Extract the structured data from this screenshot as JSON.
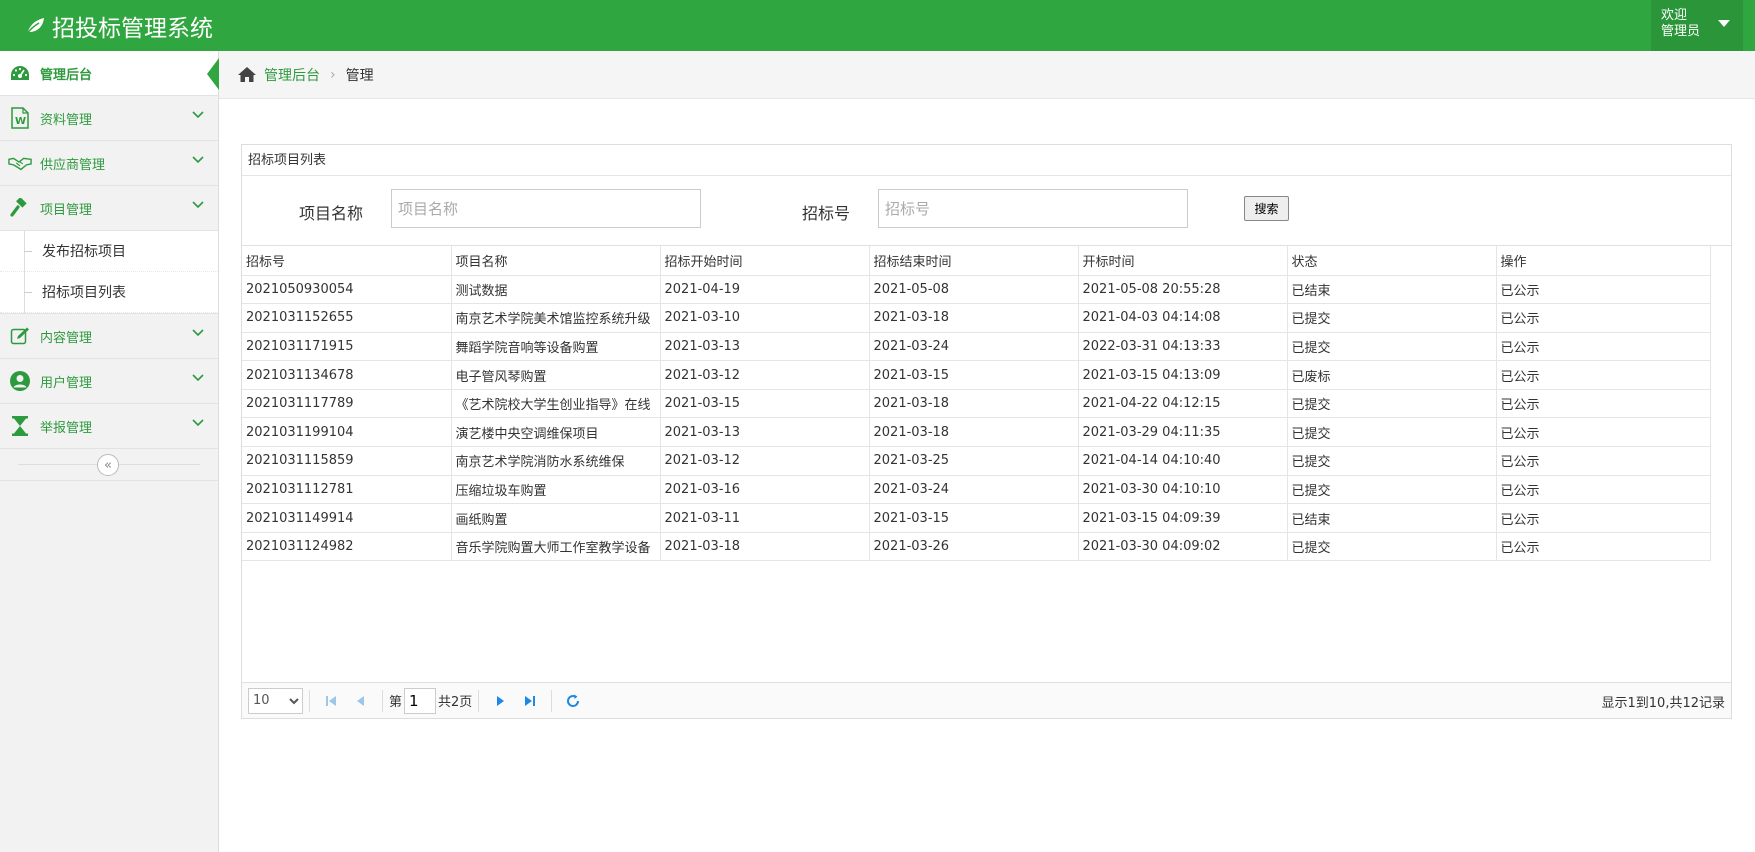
{
  "app": {
    "title": "招投标管理系统"
  },
  "user": {
    "welcome": "欢迎",
    "name": "管理员"
  },
  "sidebar": {
    "items": [
      {
        "label": "管理后台"
      },
      {
        "label": "资料管理"
      },
      {
        "label": "供应商管理"
      },
      {
        "label": "项目管理"
      },
      {
        "label": "内容管理"
      },
      {
        "label": "用户管理"
      },
      {
        "label": "举报管理"
      }
    ],
    "sub_items": [
      {
        "label": "发布招标项目"
      },
      {
        "label": "招标项目列表"
      }
    ]
  },
  "breadcrumb": {
    "home": "管理后台",
    "current": "管理"
  },
  "panel": {
    "title": "招标项目列表",
    "search": {
      "name_label": "项目名称",
      "name_placeholder": "项目名称",
      "no_label": "招标号",
      "no_placeholder": "招标号",
      "button": "搜索"
    }
  },
  "table": {
    "headers": [
      "招标号",
      "项目名称",
      "招标开始时间",
      "招标结束时间",
      "开标时间",
      "状态",
      "操作"
    ],
    "rows": [
      [
        "2021050930054",
        "测试数据",
        "2021-04-19",
        "2021-05-08",
        "2021-05-08 20:55:28",
        "已结束",
        "已公示"
      ],
      [
        "2021031152655",
        "南京艺术学院美术馆监控系统升级",
        "2021-03-10",
        "2021-03-18",
        "2021-04-03 04:14:08",
        "已提交",
        "已公示"
      ],
      [
        "2021031171915",
        "舞蹈学院音响等设备购置",
        "2021-03-13",
        "2021-03-24",
        "2022-03-31 04:13:33",
        "已提交",
        "已公示"
      ],
      [
        "2021031134678",
        "电子管风琴购置",
        "2021-03-12",
        "2021-03-15",
        "2021-03-15 04:13:09",
        "已废标",
        "已公示"
      ],
      [
        "2021031117789",
        "《艺术院校大学生创业指导》在线",
        "2021-03-15",
        "2021-03-18",
        "2021-04-22 04:12:15",
        "已提交",
        "已公示"
      ],
      [
        "2021031199104",
        "演艺楼中央空调维保项目",
        "2021-03-13",
        "2021-03-18",
        "2021-03-29 04:11:35",
        "已提交",
        "已公示"
      ],
      [
        "2021031115859",
        "南京艺术学院消防水系统维保",
        "2021-03-12",
        "2021-03-25",
        "2021-04-14 04:10:40",
        "已提交",
        "已公示"
      ],
      [
        "2021031112781",
        "压缩垃圾车购置",
        "2021-03-16",
        "2021-03-24",
        "2021-03-30 04:10:10",
        "已提交",
        "已公示"
      ],
      [
        "2021031149914",
        "画纸购置",
        "2021-03-11",
        "2021-03-15",
        "2021-03-15 04:09:39",
        "已结束",
        "已公示"
      ],
      [
        "2021031124982",
        "音乐学院购置大师工作室教学设备",
        "2021-03-18",
        "2021-03-26",
        "2021-03-30 04:09:02",
        "已提交",
        "已公示"
      ]
    ]
  },
  "pager": {
    "page_size": "10",
    "page_prefix": "第",
    "current_page": "1",
    "total_pages": "共2页",
    "info": "显示1到10,共12记录"
  },
  "colors": {
    "brand": "#2fa63f",
    "brand_dark": "#2a9639",
    "link": "#2e9a3e",
    "pager_icon": "#1e88e5"
  }
}
